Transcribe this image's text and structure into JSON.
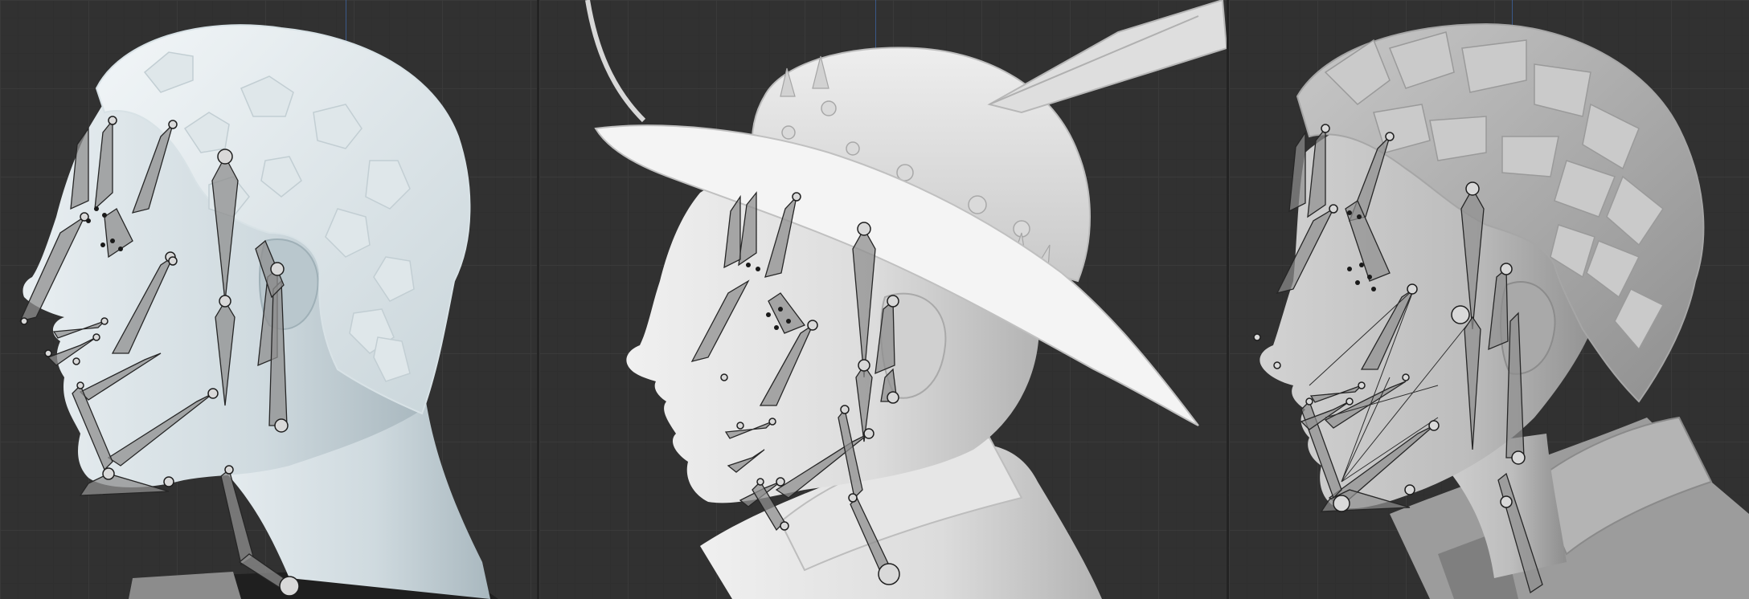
{
  "window": {
    "title": ""
  },
  "viewports": [
    {
      "id": "viewport-1",
      "subject": "head-with-short-curly-hair",
      "overlay": "facial-rig-bones"
    },
    {
      "id": "viewport-2",
      "subject": "head-with-feathered-hat",
      "overlay": "facial-rig-bones"
    },
    {
      "id": "viewport-3",
      "subject": "head-with-layered-hair",
      "overlay": "facial-rig-bones"
    }
  ],
  "colors": {
    "background": "#313131",
    "grid_major": "#3a3a3a",
    "grid_minor": "#2f2f2f",
    "axis_line": "#3f6fb8",
    "model_light_blue": "#cfd9de",
    "model_grey": "#d9d9d9",
    "model_mid_grey": "#a8a8a8",
    "bone_fill": "#8f8f8f",
    "bone_stroke": "#2a2a2a"
  }
}
